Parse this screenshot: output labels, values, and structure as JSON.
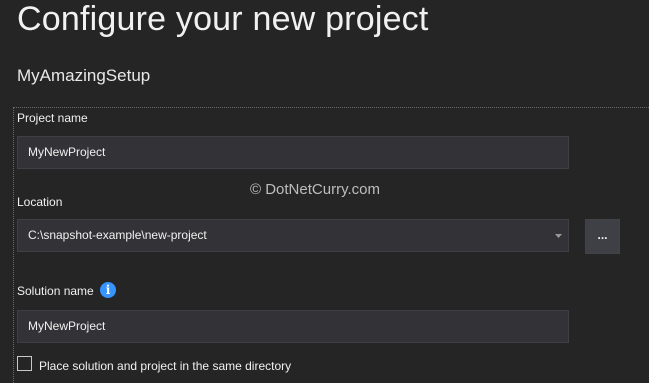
{
  "header": {
    "title": "Configure your new project",
    "template_name": "MyAmazingSetup"
  },
  "form": {
    "project_name": {
      "label": "Project name",
      "value": "MyNewProject"
    },
    "location": {
      "label": "Location",
      "value": "C:\\snapshot-example\\new-project",
      "browse_label": "..."
    },
    "solution_name": {
      "label": "Solution name",
      "info_icon": "i",
      "value": "MyNewProject"
    },
    "same_directory": {
      "label": "Place solution and project in the same directory",
      "checked": false
    }
  },
  "watermark": "© DotNetCurry.com",
  "colors": {
    "background": "#252526",
    "field_background": "#333337",
    "field_border": "#3f3f46",
    "accent": "#3794ff",
    "text": "#f1f1f1"
  }
}
